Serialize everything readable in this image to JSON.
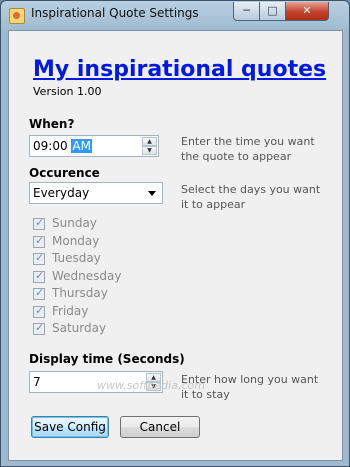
{
  "window": {
    "title": "Inspirational Quote Settings",
    "controls": {
      "minimize": "─",
      "maximize": "□",
      "close": "✕"
    }
  },
  "header": {
    "title": "My inspirational quotes",
    "version": "Version 1.00"
  },
  "when": {
    "label": "When?",
    "time_value": "09:00",
    "ampm_value": "AM",
    "hint_line1": "Enter the time you want",
    "hint_line2": "the quote to appear"
  },
  "occurence": {
    "label": "Occurence",
    "selected": "Everyday",
    "hint_line1": "Select the days you want",
    "hint_line2": "it to appear"
  },
  "days": [
    {
      "label": "Sunday",
      "checked": true
    },
    {
      "label": "Monday",
      "checked": true
    },
    {
      "label": "Tuesday",
      "checked": true
    },
    {
      "label": "Wednesday",
      "checked": true
    },
    {
      "label": "Thursday",
      "checked": true
    },
    {
      "label": "Friday",
      "checked": true
    },
    {
      "label": "Saturday",
      "checked": true
    }
  ],
  "display_time": {
    "label": "Display time (Seconds)",
    "value": "7",
    "hint_line1": "Enter how long you want",
    "hint_line2": "it to stay"
  },
  "buttons": {
    "save": "Save Config",
    "cancel": "Cancel"
  },
  "watermark": "www.softpedia.com",
  "icons": {
    "spin_up": "▲",
    "spin_down": "▼"
  }
}
